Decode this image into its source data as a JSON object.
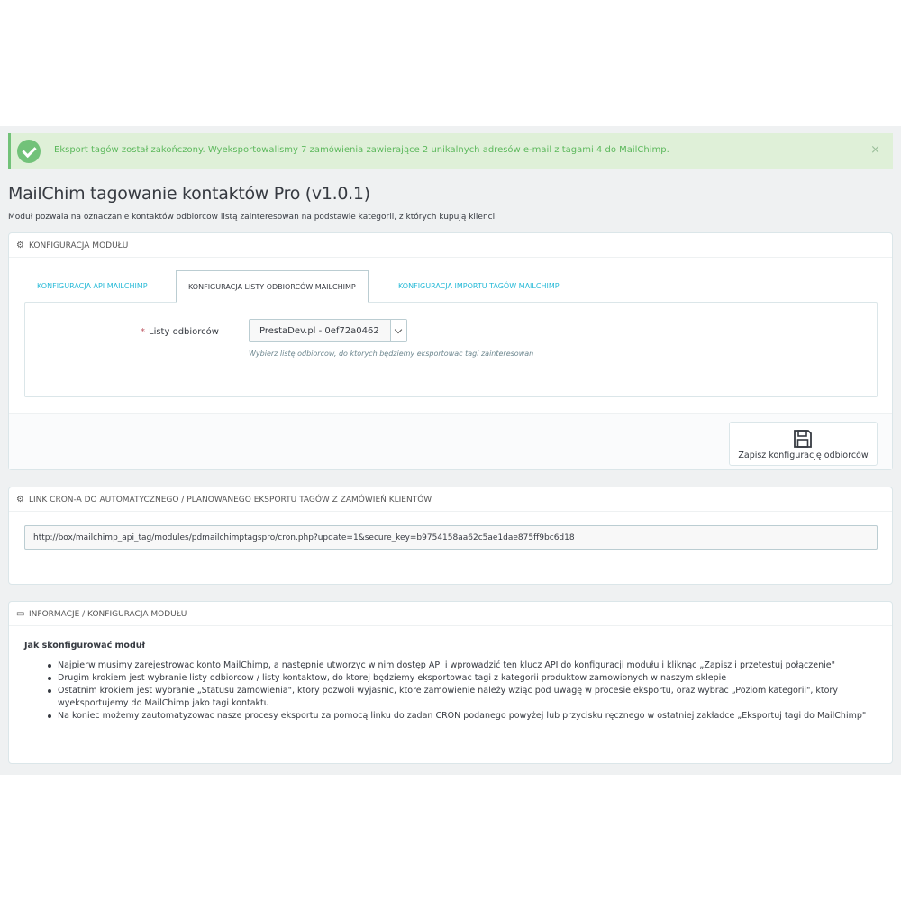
{
  "alert": {
    "message": "Eksport tagów został zakończony. Wyeksportowalismy 7 zamówienia zawierające 2 unikalnych adresów e-mail z tagami 4 do MailChimp.",
    "close": "×"
  },
  "page": {
    "title": "MailChim tagowanie kontaktów Pro (v1.0.1)",
    "subtitle": "Moduł pozwala na oznaczanie kontaktów odbiorcow listą zainteresowan na podstawie kategorii, z których kupują klienci"
  },
  "config_panel": {
    "heading": "KONFIGURACJA MODUŁU",
    "tabs": [
      {
        "label": "KONFIGURACJA API MAILCHIMP"
      },
      {
        "label": "KONFIGURACJA LISTY ODBIORCÓW MAILCHIMP"
      },
      {
        "label": "KONFIGURACJA IMPORTU TAGÓW MAILCHIMP"
      }
    ],
    "active_tab": "KONFIGURACJA LISTY ODBIORCÓW MAILCHIMP",
    "field": {
      "required_mark": "*",
      "label": "Listy odbiorców",
      "selected": "PrestaDev.pl - 0ef72a0462",
      "hint": "Wybierz listę odbiorcow, do ktorych będziemy eksportowac tagi zainteresowan"
    },
    "save_label": "Zapisz konfigurację odbiorców"
  },
  "cron_panel": {
    "heading": "LINK CRON-A DO AUTOMATYCZNEGO / PLANOWANEGO EKSPORTU TAGÓW Z ZAMÓWIEŃ KLIENTÓW",
    "url": "http://box/mailchimp_api_tag/modules/pdmailchimptagspro/cron.php?update=1&secure_key=b9754158aa62c5ae1dae875ff9bc6d18"
  },
  "info_panel": {
    "heading": "INFORMACJE / KONFIGURACJA MODUŁU",
    "subheading": "Jak skonfigurować moduł",
    "items": [
      "Najpierw musimy zarejestrowac konto MailChimp, a następnie utworzyc w nim dostęp API i wprowadzić ten klucz API do konfiguracji modułu i kliknąc „Zapisz i przetestuj połączenie\"",
      "Drugim krokiem jest wybranie listy odbiorcow / listy kontaktow, do ktorej będziemy eksportowac tagi z kategorii produktow zamowionych w naszym sklepie",
      "Ostatnim krokiem jest wybranie „Statusu zamowienia\", ktory pozwoli wyjasnic, ktore zamowienie należy wziąc pod uwagę w procesie eksportu, oraz wybrac „Poziom kategorii\", ktory wyeksportujemy do MailChimp jako tagi kontaktu",
      "Na koniec możemy zautomatyzowac nasze procesy eksportu za pomocą linku do zadan CRON podanego powyżej lub przycisku ręcznego w ostatniej zakładce „Eksportuj tagi do MailChimp\""
    ]
  },
  "icons": {
    "alert": "check-circle-icon",
    "config": "cogs-icon",
    "cron": "cogs-icon",
    "info": "credit-card-icon",
    "save": "floppy-disk-icon",
    "select": "chevron-down-icon"
  },
  "colors": {
    "accent": "#25b9d7",
    "success_bg": "#dff0d8",
    "success_text": "#5cb85c",
    "required": "#c05c67"
  }
}
